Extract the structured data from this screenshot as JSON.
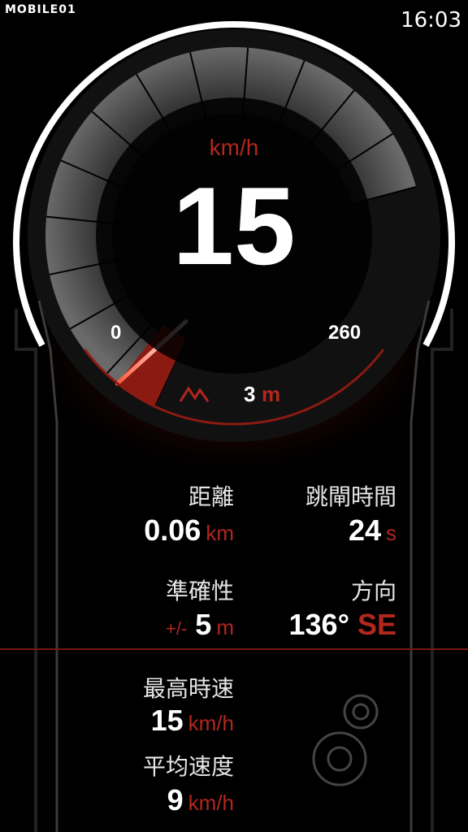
{
  "status_bar": {
    "logo": "MOBILE01",
    "time": "16:03"
  },
  "gauge": {
    "unit": "km/h",
    "speed": "15",
    "speed_value": 15,
    "scale_min": "0",
    "scale_max": "260",
    "scale_max_value": 260,
    "altitude_value": "3",
    "altitude_unit": "m",
    "altitude_icon": "mountain-icon"
  },
  "stats": {
    "distance": {
      "title": "距離",
      "value": "0.06",
      "unit": "km"
    },
    "jump_time": {
      "title": "跳閘時間",
      "value": "24",
      "unit": "s"
    },
    "accuracy": {
      "title": "準確性",
      "prefix": "+/-",
      "value": "5",
      "unit": "m"
    },
    "direction": {
      "title": "方向",
      "value": "136°",
      "cardinal": "SE"
    }
  },
  "summary": {
    "max_speed": {
      "title": "最高時速",
      "value": "15",
      "unit": "km/h"
    },
    "avg_speed": {
      "title": "平均速度",
      "value": "9",
      "unit": "km/h"
    },
    "settings_icon": "gears-icon"
  },
  "colors": {
    "accent": "#b3261e",
    "background": "#000000"
  }
}
